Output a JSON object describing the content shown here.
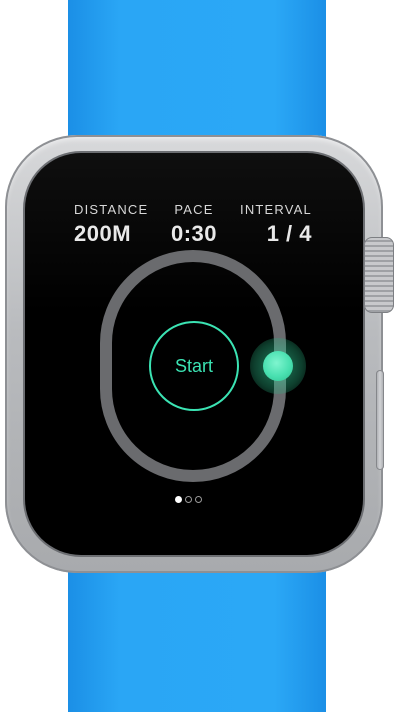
{
  "workout": {
    "distance": {
      "label": "DISTANCE",
      "value": "200M"
    },
    "pace": {
      "label": "PACE",
      "value": "0:30"
    },
    "interval": {
      "label": "INTERVAL",
      "value": "1 / 4"
    }
  },
  "start_button": {
    "label": "Start"
  },
  "pager": {
    "total": 3,
    "current": 1
  },
  "colors": {
    "accent": "#3be3b3",
    "strap": "#2aa6f5",
    "track": "#6a6b6e",
    "screen": "#000000"
  },
  "icons": {
    "runner": "runner-position-dot"
  }
}
